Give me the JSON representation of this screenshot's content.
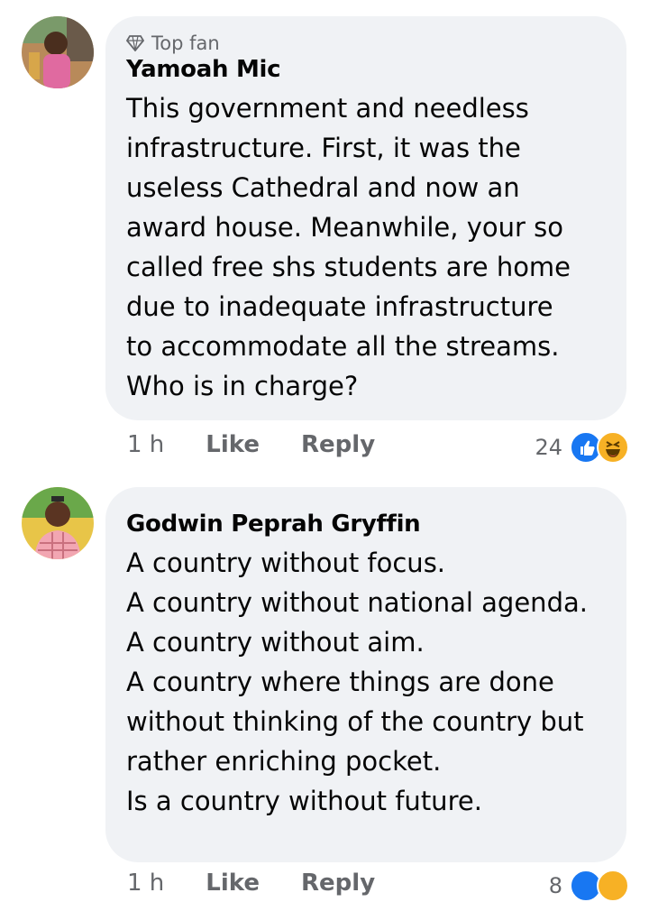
{
  "comments": [
    {
      "badge": "Top fan",
      "author": "Yamoah Mic",
      "lines": [
        "This government and needless",
        "infrastructure. First, it was the",
        "useless Cathedral and now an",
        "award house. Meanwhile, your so",
        "called free shs students are home",
        "due to inadequate infrastructure",
        "to accommodate all the streams.",
        "Who is in charge?"
      ],
      "time": "1 h",
      "like_label": "Like",
      "reply_label": "Reply",
      "reaction_count": "24",
      "reactions": [
        "like-icon",
        "haha-icon"
      ]
    },
    {
      "author": "Godwin Peprah Gryffin",
      "lines": [
        "A country without focus.",
        "A country without national agenda.",
        "A country without aim.",
        "A country where things are done",
        "without thinking of the country but",
        "rather enriching pocket.",
        "Is a country without future."
      ],
      "time": "1 h",
      "like_label": "Like",
      "reply_label": "Reply",
      "reaction_count": "8",
      "reactions": [
        "like-icon",
        "haha-icon"
      ]
    }
  ],
  "colors": {
    "bubble": "#f0f2f5",
    "meta_text": "#65676b",
    "like_blue": "#1877f2",
    "haha_yellow": "#f7b125"
  }
}
